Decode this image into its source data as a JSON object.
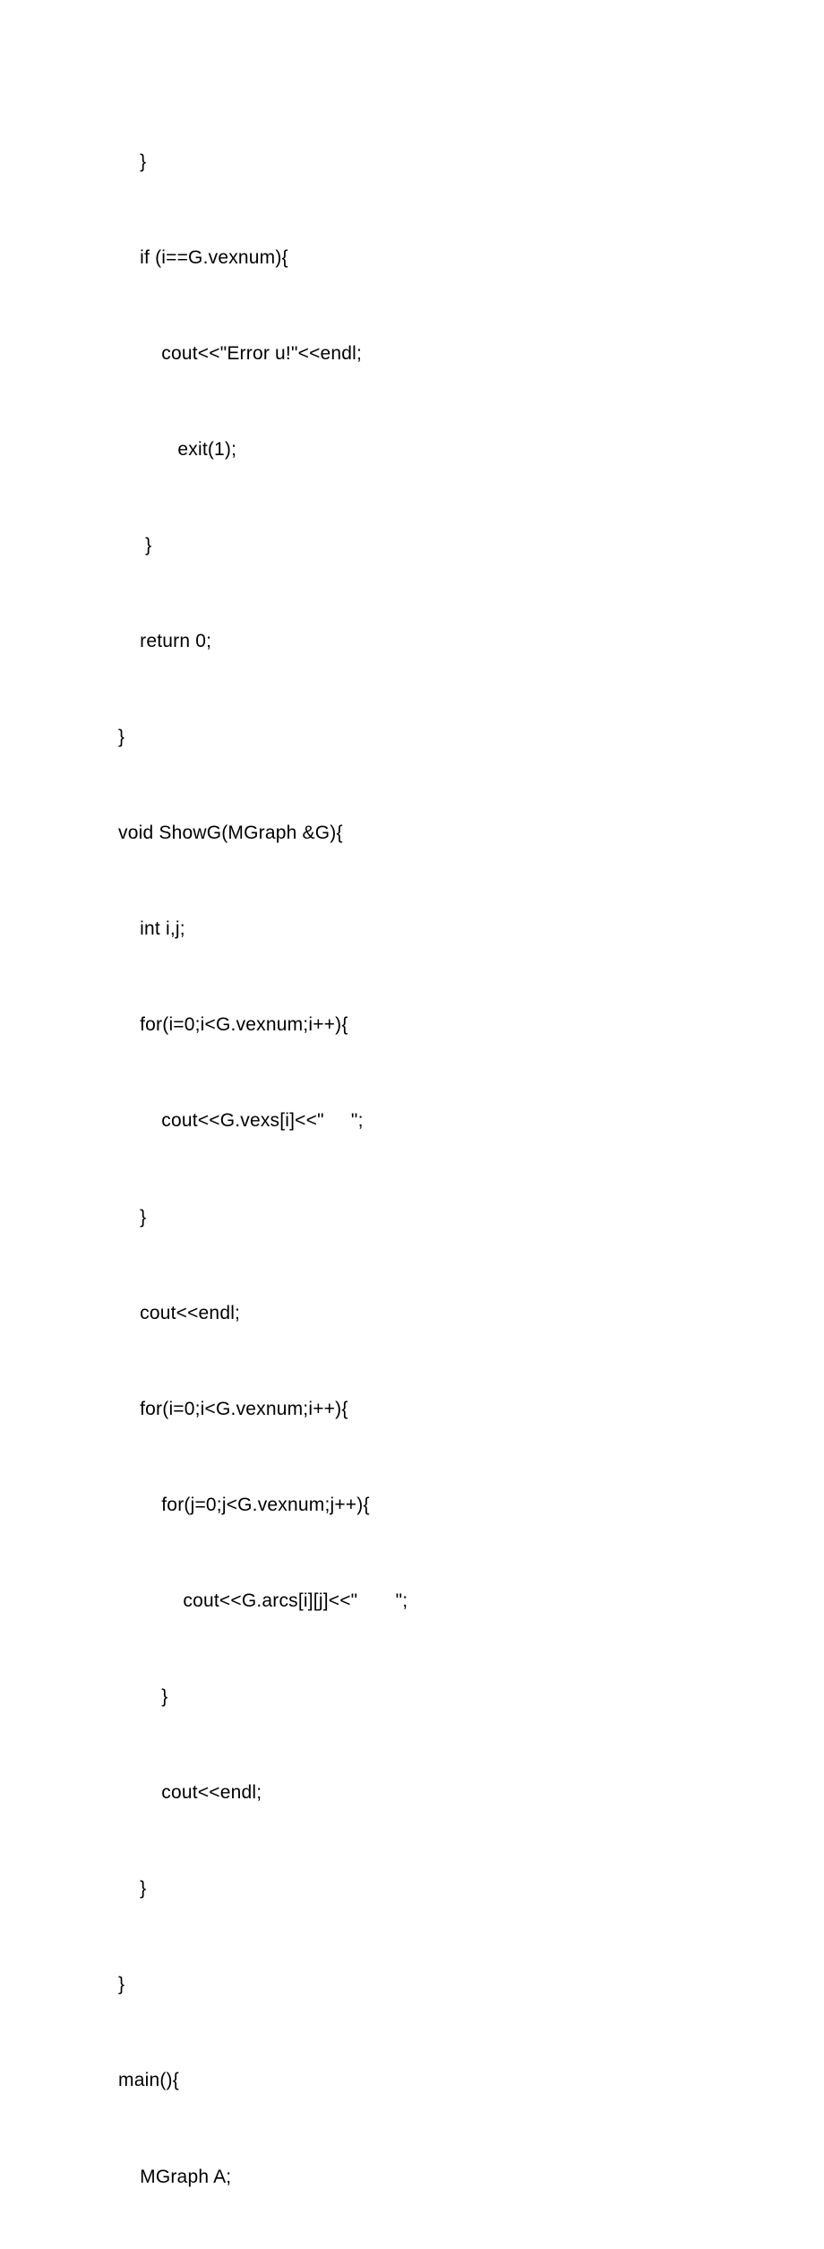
{
  "code": {
    "lines": [
      "    }",
      "    if (i==G.vexnum){",
      "        cout<<\"Error u!\"<<endl;",
      "           exit(1);",
      "     }",
      "    return 0;",
      "}",
      "void ShowG(MGraph &G){",
      "    int i,j;",
      "    for(i=0;i<G.vexnum;i++){",
      "        cout<<G.vexs[i]<<\"     \";",
      "    }",
      "    cout<<endl;",
      "    for(i=0;i<G.vexnum;i++){",
      "        for(j=0;j<G.vexnum;j++){",
      "            cout<<G.arcs[i][j]<<\"       \";",
      "        }",
      "        cout<<endl;",
      "    }",
      "}",
      "main(){",
      "    MGraph A;"
    ]
  }
}
